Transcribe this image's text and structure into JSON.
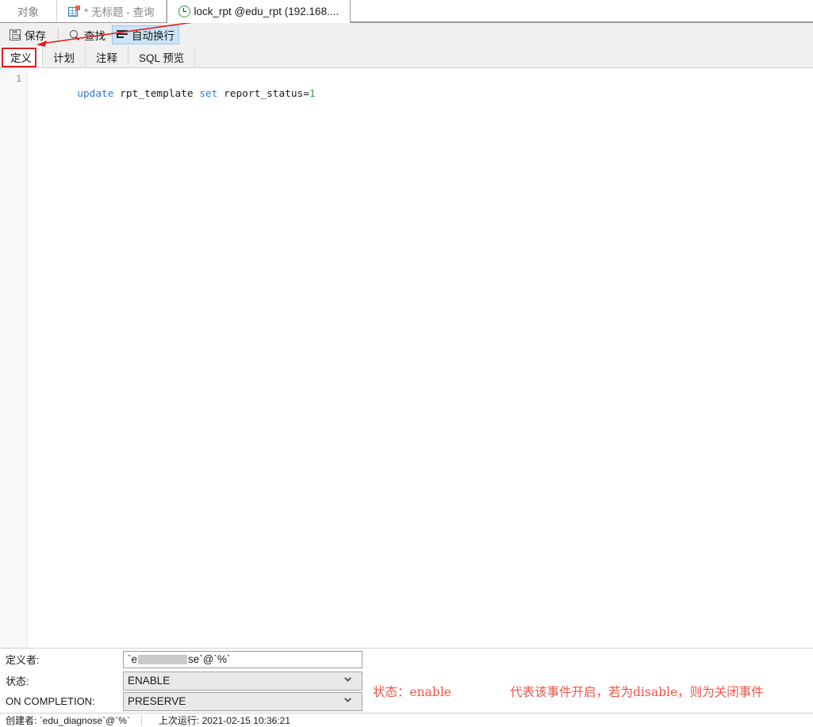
{
  "window": {
    "tabs": [
      {
        "label": "对象",
        "icon": "none",
        "active": false
      },
      {
        "label": "* 无标题 - 查询",
        "icon": "grid-icon",
        "active": false
      },
      {
        "label": "lock_rpt @edu_rpt (192.168....",
        "icon": "clock-icon",
        "active": true
      }
    ]
  },
  "toolbar": {
    "save_label": "保存",
    "find_label": "查找",
    "wrap_label": "自动换行"
  },
  "subtabs": [
    {
      "label": "定义",
      "active": true
    },
    {
      "label": "计划",
      "active": false
    },
    {
      "label": "注释",
      "active": false
    },
    {
      "label": "SQL 预览",
      "active": false
    }
  ],
  "editor": {
    "line_number": "1",
    "code_tokens": [
      {
        "text": "update",
        "type": "keyword"
      },
      {
        "text": " rpt_template ",
        "type": "plain"
      },
      {
        "text": "set",
        "type": "keyword"
      },
      {
        "text": " report_status=",
        "type": "plain"
      },
      {
        "text": "1",
        "type": "number"
      }
    ]
  },
  "properties": {
    "definer": {
      "label": "定义者:",
      "value_prefix": "`e",
      "value_suffix": "se`@`%`"
    },
    "status": {
      "label": "状态:",
      "value": "ENABLE"
    },
    "on_completion": {
      "label": "ON COMPLETION:",
      "value": "PRESERVE"
    }
  },
  "statusbar": {
    "creator": "创建者: `edu_diagnose`@`%`",
    "last_run": "上次运行: 2021-02-15 10:36:21"
  },
  "annotations": {
    "status_note": "状态：enable",
    "status_explain": "代表该事件开启，若为disable，则为关闭事件"
  },
  "colors": {
    "annotation_red": "#f0544a",
    "highlight_box_red": "#e02020",
    "selection_blue": "#cce4f7",
    "keyword_blue": "#2f7bd4",
    "number_green": "#2aa341"
  }
}
